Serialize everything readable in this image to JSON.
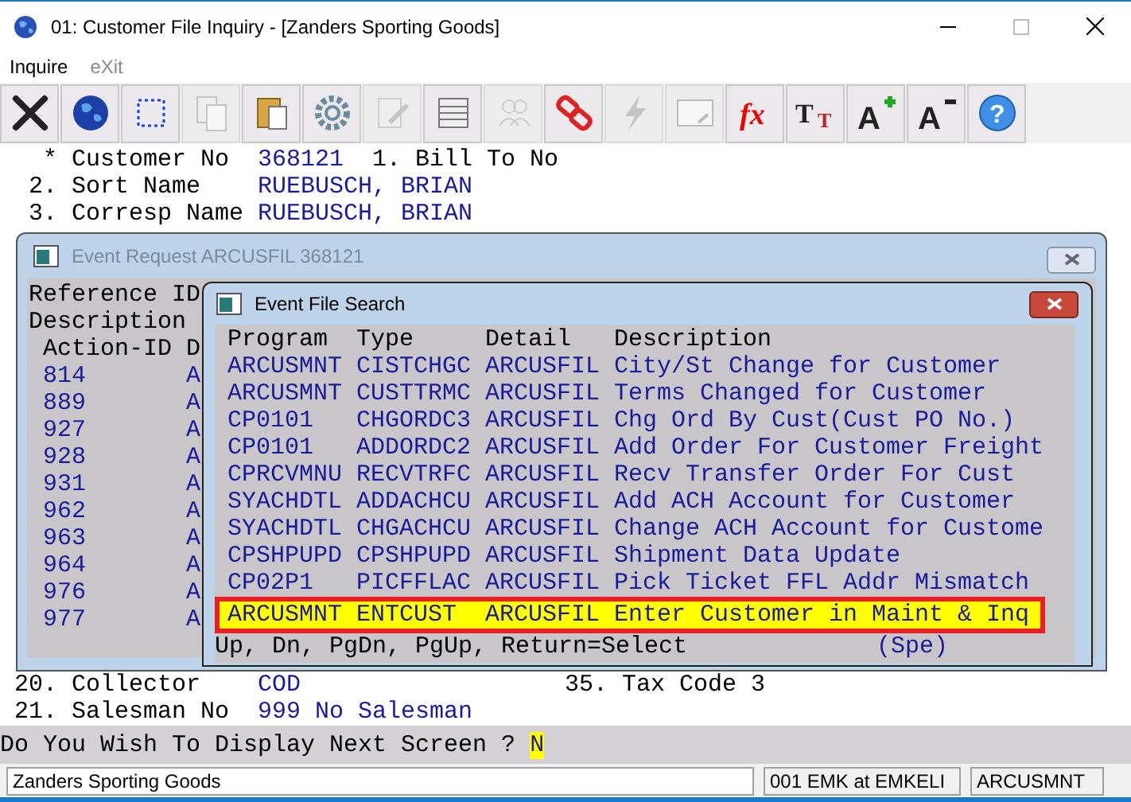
{
  "window": {
    "title": "01: Customer File Inquiry - [Zanders Sporting Goods]"
  },
  "menu": [
    {
      "label": "Inquire",
      "disabled": false
    },
    {
      "label": "eXit",
      "disabled": true
    }
  ],
  "toolbar": [
    {
      "kind": "close",
      "disabled": false
    },
    {
      "kind": "globe",
      "disabled": false
    },
    {
      "kind": "select",
      "disabled": false
    },
    {
      "kind": "copy",
      "disabled": true
    },
    {
      "kind": "paste",
      "disabled": false
    },
    {
      "kind": "gear",
      "disabled": false
    },
    {
      "kind": "edit",
      "disabled": true
    },
    {
      "kind": "table",
      "disabled": false
    },
    {
      "kind": "people",
      "disabled": true
    },
    {
      "kind": "link",
      "disabled": false
    },
    {
      "kind": "bolt",
      "disabled": true
    },
    {
      "kind": "window",
      "disabled": true
    },
    {
      "kind": "fx",
      "disabled": false,
      "glyphs": [
        "fx"
      ]
    },
    {
      "kind": "font",
      "disabled": false,
      "glyphs": [
        "T",
        "T"
      ]
    },
    {
      "kind": "grow",
      "disabled": false,
      "glyphs": [
        "A"
      ]
    },
    {
      "kind": "shrink",
      "disabled": false,
      "glyphs": [
        "A"
      ]
    },
    {
      "kind": "help",
      "disabled": false,
      "glyphs": [
        "?"
      ]
    }
  ],
  "fields": [
    {
      "number": "*",
      "label": "Customer No",
      "value": "368121",
      "note": "1. Bill To No"
    },
    {
      "number": "2.",
      "label": "Sort Name",
      "value": "RUEBUSCH, BRIAN"
    },
    {
      "number": "3.",
      "label": "Corresp Name",
      "value": "RUEBUSCH, BRIAN"
    }
  ],
  "event_request": {
    "title": "Event Request ARCUSFIL 368121",
    "reference_label": "Reference ID",
    "description_label": "Description",
    "columns": [
      "Action-ID",
      "D"
    ],
    "rows": [
      {
        "action_id": "814",
        "column_2": "A"
      },
      {
        "action_id": "889",
        "column_2": "A"
      },
      {
        "action_id": "927",
        "column_2": "A"
      },
      {
        "action_id": "928",
        "column_2": "A"
      },
      {
        "action_id": "931",
        "column_2": "A"
      },
      {
        "action_id": "962",
        "column_2": "A"
      },
      {
        "action_id": "963",
        "column_2": "A"
      },
      {
        "action_id": "964",
        "column_2": "A"
      },
      {
        "action_id": "976",
        "column_2": "A"
      },
      {
        "action_id": "977",
        "column_2": "A"
      }
    ]
  },
  "event_search": {
    "title": "Event File Search",
    "columns": [
      "Program",
      "Type",
      "Detail",
      "Description"
    ],
    "rows": [
      {
        "program": "ARCUSMNT",
        "type": "CISTCHGC",
        "detail": "ARCUSFIL",
        "description": "City/St Change for Customer",
        "selected": false
      },
      {
        "program": "ARCUSMNT",
        "type": "CUSTTRMC",
        "detail": "ARCUSFIL",
        "description": "Terms Changed for Customer",
        "selected": false
      },
      {
        "program": "CP0101",
        "type": "CHGORDC3",
        "detail": "ARCUSFIL",
        "description": "Chg Ord By Cust(Cust PO No.)",
        "selected": false
      },
      {
        "program": "CP0101",
        "type": "ADDORDC2",
        "detail": "ARCUSFIL",
        "description": "Add Order For Customer Freight",
        "selected": false
      },
      {
        "program": "CPRCVMNU",
        "type": "RECVTRFC",
        "detail": "ARCUSFIL",
        "description": "Recv Transfer Order For Cust",
        "selected": false
      },
      {
        "program": "SYACHDTL",
        "type": "ADDACHCU",
        "detail": "ARCUSFIL",
        "description": "Add ACH Account for Customer",
        "selected": false
      },
      {
        "program": "SYACHDTL",
        "type": "CHGACHCU",
        "detail": "ARCUSFIL",
        "description": "Change ACH Account for Custome",
        "selected": false
      },
      {
        "program": "CPSHPUPD",
        "type": "CPSHPUPD",
        "detail": "ARCUSFIL",
        "description": "Shipment Data Update",
        "selected": false
      },
      {
        "program": "CP02P1",
        "type": "PICFFLAC",
        "detail": "ARCUSFIL",
        "description": "Pick Ticket FFL Addr Mismatch",
        "selected": false
      },
      {
        "program": "ARCUSMNT",
        "type": "ENTCUST",
        "detail": "ARCUSFIL",
        "description": "Enter Customer in Maint & Inq",
        "selected": true
      }
    ],
    "footer": "Up, Dn, PgDn, PgUp, Return=Select",
    "footer_note": "(Spe)"
  },
  "bottom_fields": [
    {
      "number": "20.",
      "label": "Collector",
      "value": "COD",
      "note": "35. Tax Code 3"
    },
    {
      "number": "21.",
      "label": "Salesman No",
      "value": "999 No Salesman"
    }
  ],
  "prompt": {
    "text": "Do You Wish To Display Next Screen ?",
    "value": "N"
  },
  "status_bar": [
    "Zanders Sporting Goods",
    "001 EMK at EMKELI",
    "ARCUSMNT"
  ]
}
